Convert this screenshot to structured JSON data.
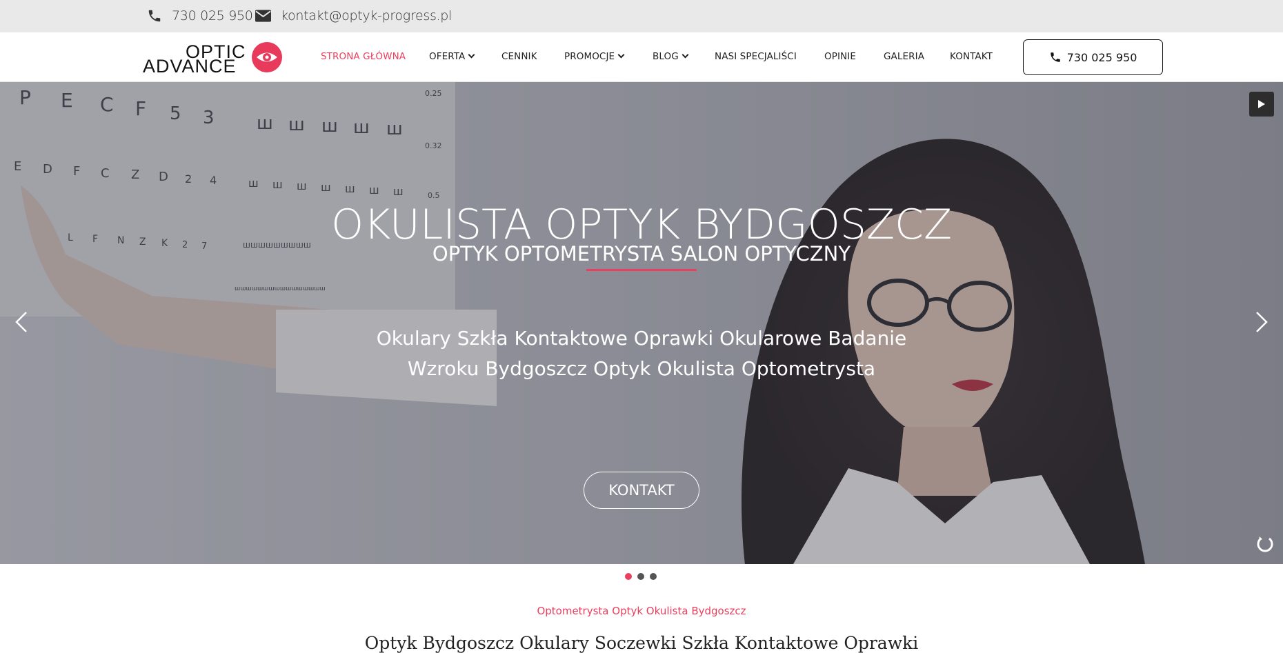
{
  "topbar": {
    "phone": "730 025 950",
    "email": "kontakt@optyk-progress.pl"
  },
  "logo": {
    "line1": "OPTIC",
    "line2": "ADVANCE"
  },
  "nav": {
    "items": [
      {
        "label": "STRONA GŁÓWNA",
        "active": true,
        "dropdown": false
      },
      {
        "label": "OFERTA",
        "active": false,
        "dropdown": true
      },
      {
        "label": "CENNIK",
        "active": false,
        "dropdown": false
      },
      {
        "label": "PROMOCJE",
        "active": false,
        "dropdown": true
      },
      {
        "label": "BLOG",
        "active": false,
        "dropdown": true
      },
      {
        "label": "NASI SPECJALIŚCI",
        "active": false,
        "dropdown": false
      },
      {
        "label": "OPINIE",
        "active": false,
        "dropdown": false
      },
      {
        "label": "GALERIA",
        "active": false,
        "dropdown": false
      },
      {
        "label": "KONTAKT",
        "active": false,
        "dropdown": false
      }
    ],
    "call_button": "730 025 950"
  },
  "hero": {
    "title": "OKULISTA OPTYK BYDGOSZCZ",
    "subtitle": "OPTYK OPTOMETRYSTA SALON OPTYCZNY",
    "tagline_line1": "Okulary Szkła Kontaktowe Oprawki Okularowe Badanie",
    "tagline_line2": "Wzroku Bydgoszcz Optyk Okulista Optometrysta",
    "cta": "KONTAKT",
    "slides_count": 3,
    "active_slide": 1
  },
  "section": {
    "eyebrow": "Optometrysta Optyk Okulista Bydgoszcz",
    "title": "Optyk Bydgoszcz Okulary Soczewki Szkła Kontaktowe Oprawki"
  },
  "colors": {
    "accent": "#e8405e",
    "topbar_bg": "#e9e9e9",
    "text": "#222222"
  },
  "icons": {
    "phone": "phone-icon",
    "mail": "envelope-icon",
    "play": "play-icon",
    "prev": "chevron-left-icon",
    "next": "chevron-right-icon",
    "reload": "reload-icon"
  }
}
